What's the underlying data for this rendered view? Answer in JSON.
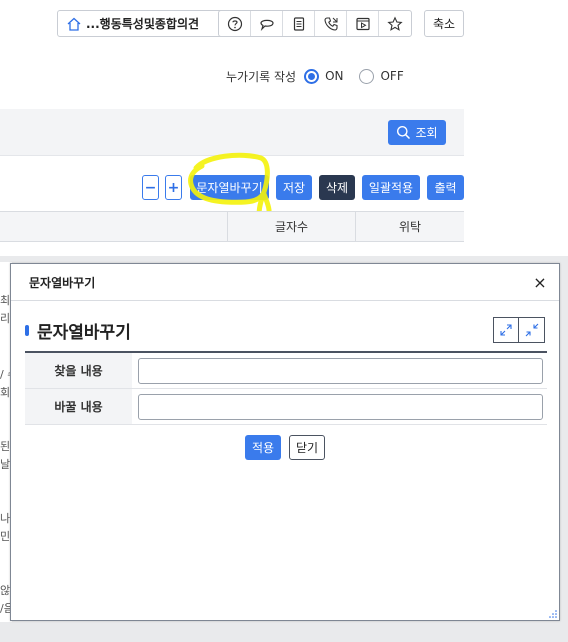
{
  "toolbar": {
    "breadcrumb_label": "...행동특성및종합의견",
    "shrink_label": "축소",
    "icons": [
      "help-icon",
      "chat-icon",
      "document-icon",
      "phone-icon",
      "video-icon",
      "star-icon"
    ]
  },
  "record_option": {
    "label": "누가기록 작성",
    "on_label": "ON",
    "off_label": "OFF",
    "selected": "ON"
  },
  "search": {
    "button_label": "조회"
  },
  "actions": {
    "minus_label": "−",
    "plus_label": "+",
    "replace_label": "문자열바꾸기",
    "save_label": "저장",
    "delete_label": "삭제",
    "bulk_apply_label": "일괄적용",
    "print_label": "출력"
  },
  "grid": {
    "columns": [
      "글자수",
      "위탁"
    ]
  },
  "background_fragments": [
    "최",
    "리",
    "/ 수",
    "회",
    "된",
    "날",
    "나",
    "민",
    "않",
    "/음"
  ],
  "modal": {
    "title": "문자열바꾸기",
    "section_title": "문자열바꾸기",
    "find_label": "찾을 내용",
    "find_value": "",
    "replace_label": "바꿀 내용",
    "replace_value": "",
    "apply_label": "적용",
    "close_label": "닫기",
    "close_glyph": "×"
  },
  "colors": {
    "primary": "#3a7bec",
    "dark": "#2a3850",
    "highlight": "#f4f20a"
  }
}
